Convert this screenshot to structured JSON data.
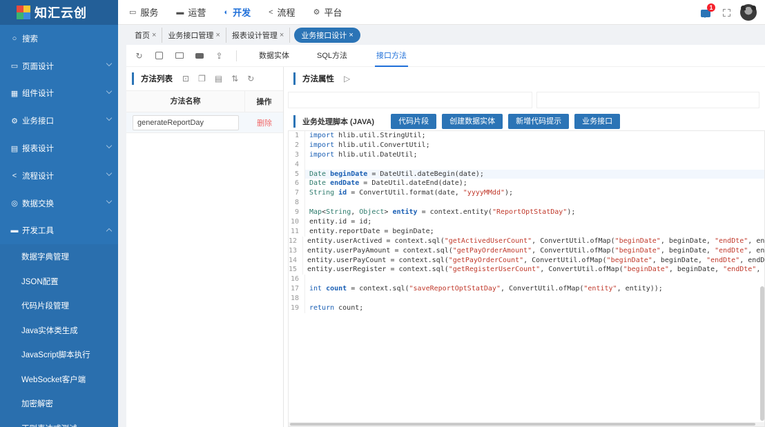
{
  "app": {
    "brand": "知汇云创"
  },
  "sidebar": {
    "items": [
      {
        "label": "搜索",
        "icon": "search-icon",
        "glyph": "○"
      },
      {
        "label": "页面设计",
        "icon": "page-icon",
        "glyph": "▭"
      },
      {
        "label": "组件设计",
        "icon": "grid-icon",
        "glyph": "▦"
      },
      {
        "label": "业务接口",
        "icon": "settings-icon",
        "glyph": "⚙"
      },
      {
        "label": "报表设计",
        "icon": "report-icon",
        "glyph": "▤"
      },
      {
        "label": "流程设计",
        "icon": "share-icon",
        "glyph": "<"
      },
      {
        "label": "数据交换",
        "icon": "database-icon",
        "glyph": "◎"
      },
      {
        "label": "开发工具",
        "icon": "toolbox-icon",
        "glyph": "▬"
      }
    ],
    "subitems": [
      "数据字典管理",
      "JSON配置",
      "代码片段管理",
      "Java实体类生成",
      "JavaScript脚本执行",
      "WebSocket客户端",
      "加密解密",
      "正则表达式测试"
    ]
  },
  "topnav": {
    "items": [
      {
        "label": "服务",
        "glyph": "▭"
      },
      {
        "label": "运营",
        "glyph": "▬"
      },
      {
        "label": "开发",
        "glyph": "◐",
        "active": true
      },
      {
        "label": "流程",
        "glyph": "<"
      },
      {
        "label": "平台",
        "glyph": "⚙"
      }
    ],
    "notification_count": "1"
  },
  "tabs": [
    {
      "label": "首页"
    },
    {
      "label": "业务接口管理"
    },
    {
      "label": "报表设计管理"
    },
    {
      "label": "业务接口设计",
      "active": true
    }
  ],
  "subtabs": [
    {
      "label": "数据实体"
    },
    {
      "label": "SQL方法"
    },
    {
      "label": "接口方法",
      "active": true
    }
  ],
  "method_list": {
    "title": "方法列表",
    "col_name": "方法名称",
    "col_op": "操作",
    "rows": [
      {
        "name": "generateReportDay",
        "action": "删除"
      }
    ]
  },
  "method_props": {
    "title": "方法属性"
  },
  "script": {
    "title": "业务处理脚本 (JAVA)",
    "buttons": [
      "代码片段",
      "创建数据实体",
      "新增代码提示",
      "业务接口"
    ],
    "lines": [
      "import hlib.util.StringUtil;",
      "import hlib.util.ConvertUtil;",
      "import hlib.util.DateUtil;",
      "",
      "Date beginDate = DateUtil.dateBegin(date);",
      "Date endDate = DateUtil.dateEnd(date);",
      "String id = ConvertUtil.format(date, \"yyyyMMdd\");",
      "",
      "Map<String, Object> entity = context.entity(\"ReportOptStatDay\");",
      "entity.id = id;",
      "entity.reportDate = beginDate;",
      "entity.userActived = context.sql(\"getActivedUserCount\", ConvertUtil.ofMap(\"beginDate\", beginDate, \"endDte\", endDate));",
      "entity.userPayAmount = context.sql(\"getPayOrderAmount\", ConvertUtil.ofMap(\"beginDate\", beginDate, \"endDte\", endDate));",
      "entity.userPayCount = context.sql(\"getPayOrderCount\", ConvertUtil.ofMap(\"beginDate\", beginDate, \"endDte\", endDate));",
      "entity.userRegister = context.sql(\"getRegisterUserCount\", ConvertUtil.ofMap(\"beginDate\", beginDate, \"endDte\", endDate));",
      "",
      "int count = context.sql(\"saveReportOptStatDay\", ConvertUtil.ofMap(\"entity\", entity));",
      "",
      "return count;"
    ],
    "current_line": 5
  },
  "colors": {
    "primary": "#2b74b6",
    "accent": "#1e6fd9",
    "danger": "#f06a6a"
  }
}
